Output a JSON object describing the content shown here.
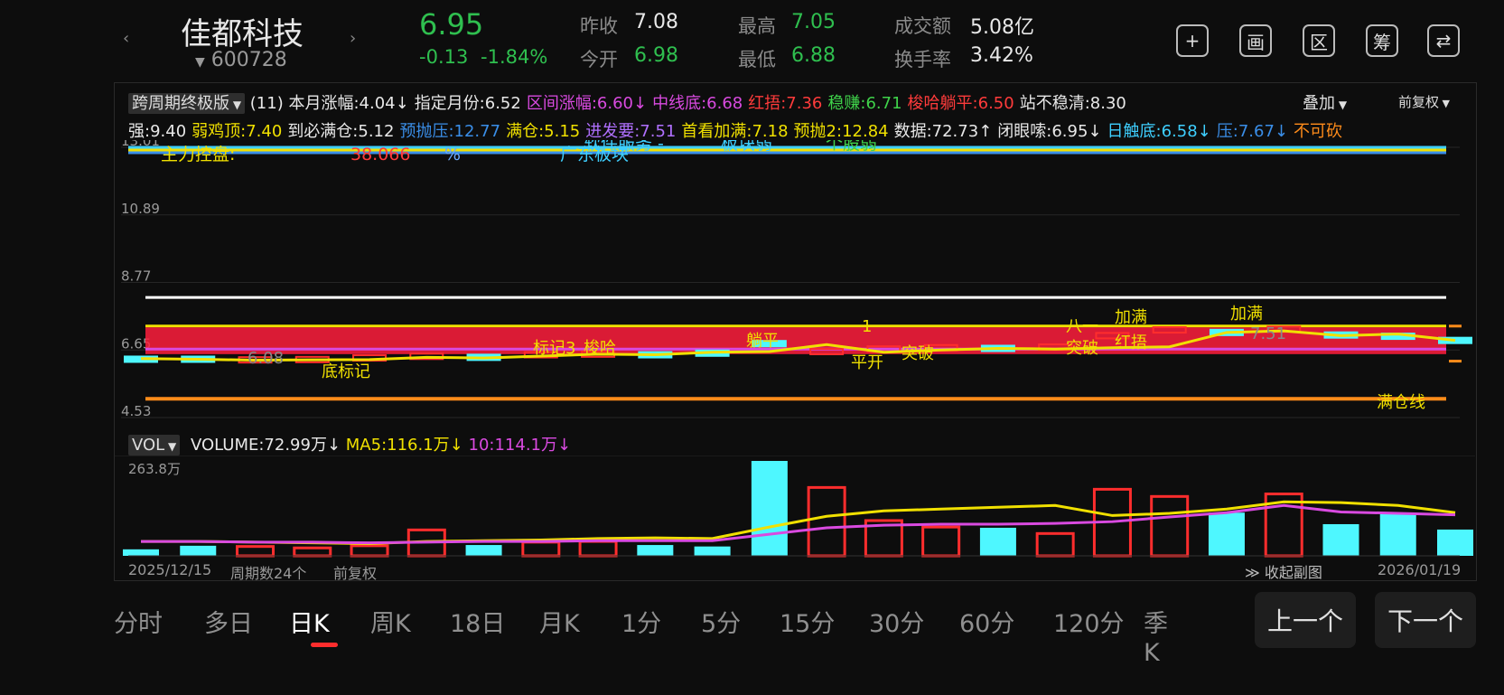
{
  "header": {
    "prev_arrow": "‹",
    "next_arrow": "›",
    "stock_name": "佳都科技",
    "stock_code": "600728",
    "price": "6.95",
    "change": "-0.13",
    "change_pct": "-1.84%",
    "stats": [
      {
        "label": "昨收",
        "value": "7.08"
      },
      {
        "label": "今开",
        "value": "6.98"
      },
      {
        "label": "最高",
        "value": "7.05"
      },
      {
        "label": "最低",
        "value": "6.88"
      },
      {
        "label": "成交额",
        "value": "5.08亿"
      },
      {
        "label": "换手率",
        "value": "3.42%"
      }
    ],
    "icons": [
      "add-icon",
      "screen-icon",
      "range-icon",
      "chip-icon",
      "rotate-icon"
    ],
    "icon_glyphs": [
      "+",
      "画",
      "区",
      "筹",
      "⇄"
    ]
  },
  "indicator": {
    "selector": "跨周期终极版",
    "param": "(11)",
    "row1": [
      {
        "text": "本月涨幅:4.04↓",
        "color": "#e8e8e8"
      },
      {
        "text": "指定月份:6.52",
        "color": "#e8e8e8"
      },
      {
        "text": "区间涨幅:6.60↓",
        "color": "#d94ae0"
      },
      {
        "text": "中线底:6.68",
        "color": "#d94ae0"
      },
      {
        "text": "红捂:7.36",
        "color": "#ff3b3b"
      },
      {
        "text": "稳赚:6.71",
        "color": "#3fd24a"
      },
      {
        "text": "梭哈躺平:6.50",
        "color": "#ff3b3b"
      },
      {
        "text": "站不稳清:8.30",
        "color": "#e8e8e8"
      }
    ],
    "overlay_label": "叠加",
    "restore_label": "前复权",
    "row2": [
      {
        "text": "强:9.40",
        "color": "#e8e8e8"
      },
      {
        "text": "弱鸡顶:7.40",
        "color": "#f0e000"
      },
      {
        "text": "到必满仓:5.12",
        "color": "#e8e8e8"
      },
      {
        "text": "预抛压:12.77",
        "color": "#3a8ee8"
      },
      {
        "text": "满仓:5.15",
        "color": "#f0e000"
      },
      {
        "text": "进发要:7.51",
        "color": "#b070ff"
      },
      {
        "text": "首看加满:7.18",
        "color": "#f0e000"
      },
      {
        "text": "预抛2:12.84",
        "color": "#f0e000"
      },
      {
        "text": "数据:72.73↑",
        "color": "#e8e8e8"
      },
      {
        "text": "闭眼嗦:6.95↓",
        "color": "#e8e8e8"
      },
      {
        "text": "日触底:6.58↓",
        "color": "#3ecfff"
      },
      {
        "text": "压:7.67↓",
        "color": "#3a8ee8"
      },
      {
        "text": "不可砍",
        "color": "#ff8c1a"
      }
    ]
  },
  "main_chart": {
    "y_ticks": [
      "13.01",
      "10.89",
      "8.77",
      "6.65",
      "4.53"
    ],
    "overlay_texts": [
      {
        "text": "主力控盘:",
        "color": "#f0e000"
      },
      {
        "text": "38.066",
        "color": "#ff3b3b"
      },
      {
        "text": "%",
        "color": "#6aa8ff"
      },
      {
        "text": "广东板块",
        "color": "#3ecfff"
      },
      {
        "text": "软件服务 -",
        "color": "#3ecfff"
      },
      {
        "text": "板块弱",
        "color": "#3ecfff"
      },
      {
        "text": "个股弱",
        "color": "#3fd24a"
      }
    ],
    "annotations": [
      "6.08",
      "底标记",
      "标记3",
      "梭哈",
      "躺平",
      "1",
      "平开",
      "突破",
      "八一",
      "突破",
      "加满",
      "红捂",
      "加满",
      "7.51",
      "满仓线"
    ]
  },
  "volume": {
    "selector": "VOL",
    "volume_label": "VOLUME:72.99万↓",
    "ma5_label": "MA5:116.1万↓",
    "ma10_label": "10:114.1万↓",
    "max_label": "263.8万"
  },
  "footer": {
    "start_date": "2025/12/15",
    "period_count": "周期数24个",
    "restore": "前复权",
    "collapse": "收起副图",
    "end_date": "2026/01/19"
  },
  "tabs": [
    "分时",
    "多日",
    "日K",
    "周K",
    "18日",
    "月K",
    "1分",
    "5分",
    "15分",
    "30分",
    "60分",
    "120分",
    "季K"
  ],
  "active_tab": "日K",
  "nav": {
    "prev": "上一个",
    "next": "下一个"
  },
  "chart_data": {
    "type": "candlestick",
    "y_range": [
      4.53,
      13.01
    ],
    "levels": {
      "white_line": 8.3,
      "yellow_line": 7.4,
      "orange_line_full_position": 5.12,
      "red_band_top": 7.36,
      "magenta_line": 6.68
    },
    "close_line": [
      6.38,
      6.36,
      6.33,
      6.34,
      6.35,
      6.42,
      6.4,
      6.46,
      6.52,
      6.5,
      6.58,
      6.6,
      6.82,
      6.58,
      6.65,
      6.7,
      6.68,
      6.72,
      6.75,
      7.2,
      7.25,
      7.1,
      7.15,
      6.95
    ],
    "candles": [
      {
        "color": "cyan",
        "value": 6.36
      },
      {
        "color": "cyan",
        "value": 6.36
      },
      {
        "color": "red",
        "value": 6.34
      },
      {
        "color": "red",
        "value": 6.35
      },
      {
        "color": "red",
        "value": 6.4
      },
      {
        "color": "red",
        "value": 6.45
      },
      {
        "color": "cyan",
        "value": 6.42
      },
      {
        "color": "red",
        "value": 6.5
      },
      {
        "color": "red",
        "value": 6.52
      },
      {
        "color": "cyan",
        "value": 6.5
      },
      {
        "color": "cyan",
        "value": 6.55
      },
      {
        "color": "cyan",
        "value": 6.85
      },
      {
        "color": "red",
        "value": 6.6
      },
      {
        "color": "red",
        "value": 6.68
      },
      {
        "color": "red",
        "value": 6.72
      },
      {
        "color": "cyan",
        "value": 6.7
      },
      {
        "color": "red",
        "value": 6.74
      },
      {
        "color": "red",
        "value": 7.1
      },
      {
        "color": "red",
        "value": 7.28
      },
      {
        "color": "cyan",
        "value": 7.2
      },
      {
        "color": "red",
        "value": 7.3
      },
      {
        "color": "cyan",
        "value": 7.12
      },
      {
        "color": "cyan",
        "value": 7.08
      },
      {
        "color": "cyan",
        "value": 6.95
      }
    ],
    "volume_unit": "万",
    "volume_max": 263.8,
    "volume": [
      {
        "v": 18,
        "up": false
      },
      {
        "v": 28,
        "up": false
      },
      {
        "v": 26,
        "up": true
      },
      {
        "v": 22,
        "up": true
      },
      {
        "v": 28,
        "up": true
      },
      {
        "v": 72,
        "up": true
      },
      {
        "v": 30,
        "up": false
      },
      {
        "v": 38,
        "up": true
      },
      {
        "v": 40,
        "up": true
      },
      {
        "v": 30,
        "up": false
      },
      {
        "v": 26,
        "up": false
      },
      {
        "v": 263.8,
        "up": false
      },
      {
        "v": 190,
        "up": true
      },
      {
        "v": 98,
        "up": true
      },
      {
        "v": 80,
        "up": true
      },
      {
        "v": 78,
        "up": false
      },
      {
        "v": 62,
        "up": true
      },
      {
        "v": 185,
        "up": true
      },
      {
        "v": 165,
        "up": true
      },
      {
        "v": 120,
        "up": false
      },
      {
        "v": 172,
        "up": true
      },
      {
        "v": 88,
        "up": false
      },
      {
        "v": 118,
        "up": false
      },
      {
        "v": 72.99,
        "up": false
      }
    ],
    "ma5": [
      40,
      40,
      38,
      36,
      34,
      40,
      42,
      44,
      48,
      50,
      48,
      80,
      110,
      125,
      130,
      135,
      140,
      112,
      118,
      130,
      150,
      148,
      140,
      120
    ],
    "ma10": [
      40,
      40,
      38,
      38,
      36,
      38,
      40,
      40,
      42,
      42,
      42,
      60,
      78,
      85,
      88,
      88,
      90,
      95,
      108,
      120,
      140,
      122,
      118,
      114
    ]
  }
}
